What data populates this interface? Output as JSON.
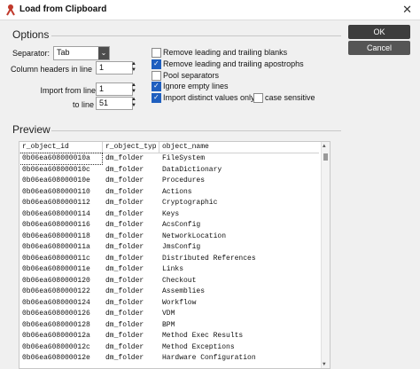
{
  "window": {
    "title": "Load from Clipboard"
  },
  "sections": {
    "options": "Options",
    "preview": "Preview"
  },
  "options": {
    "separator_label": "Separator:",
    "separator_value": "Tab",
    "column_headers_label": "Column headers in line",
    "column_headers_value": "1",
    "import_from_label": "Import from line",
    "import_from_value": "1",
    "to_line_label": "to line",
    "to_line_value": "51"
  },
  "checkboxes": [
    {
      "label": "Remove leading and trailing blanks",
      "checked": false
    },
    {
      "label": "Remove leading and trailing apostrophs",
      "checked": true
    },
    {
      "label": "Pool separators",
      "checked": false
    },
    {
      "label": "Ignore empty lines",
      "checked": true
    },
    {
      "label": "Import distinct values only",
      "checked": true
    },
    {
      "label": "case sensitive",
      "checked": false
    }
  ],
  "buttons": {
    "ok": "OK",
    "cancel": "Cancel"
  },
  "preview": {
    "columns": [
      "r_object_id",
      "r_object_typ",
      "object_name"
    ],
    "rows": [
      [
        "0b06ea608000010a",
        "dm_folder",
        "FileSystem"
      ],
      [
        "0b06ea608000010c",
        "dm_folder",
        "DataDictionary"
      ],
      [
        "0b06ea608000010e",
        "dm_folder",
        "Procedures"
      ],
      [
        "0b06ea6080000110",
        "dm_folder",
        "Actions"
      ],
      [
        "0b06ea6080000112",
        "dm_folder",
        "Cryptographic"
      ],
      [
        "0b06ea6080000114",
        "dm_folder",
        "Keys"
      ],
      [
        "0b06ea6080000116",
        "dm_folder",
        "AcsConfig"
      ],
      [
        "0b06ea6080000118",
        "dm_folder",
        "NetworkLocation"
      ],
      [
        "0b06ea608000011a",
        "dm_folder",
        "JmsConfig"
      ],
      [
        "0b06ea608000011c",
        "dm_folder",
        "Distributed References"
      ],
      [
        "0b06ea608000011e",
        "dm_folder",
        "Links"
      ],
      [
        "0b06ea6080000120",
        "dm_folder",
        "Checkout"
      ],
      [
        "0b06ea6080000122",
        "dm_folder",
        "Assemblies"
      ],
      [
        "0b06ea6080000124",
        "dm_folder",
        "Workflow"
      ],
      [
        "0b06ea6080000126",
        "dm_folder",
        "VDM"
      ],
      [
        "0b06ea6080000128",
        "dm_folder",
        "BPM"
      ],
      [
        "0b06ea608000012a",
        "dm_folder",
        "Method Exec Results"
      ],
      [
        "0b06ea608000012c",
        "dm_folder",
        "Method Exceptions"
      ],
      [
        "0b06ea608000012e",
        "dm_folder",
        "Hardware Configuration"
      ]
    ]
  },
  "colors": {
    "checkbox_accent": "#1f5fbf",
    "button_dark": "#3d3d3d",
    "app_icon": "#c0392b"
  },
  "icons": {
    "app": "app-icon",
    "close": "close-icon",
    "dropdown": "chevron-down-icon"
  }
}
